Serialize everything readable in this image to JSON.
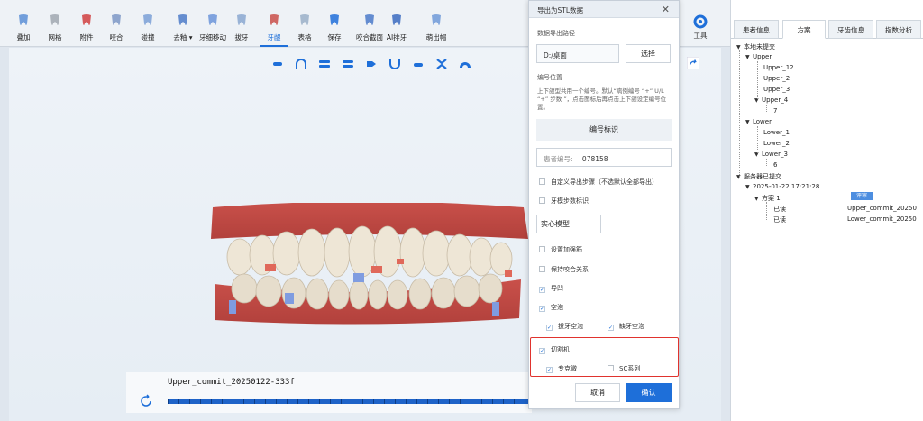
{
  "toolbar": {
    "items": [
      {
        "label": "叠加",
        "icon": "tooth-stack-icon"
      },
      {
        "label": "网格",
        "icon": "grid-icon"
      },
      {
        "label": "附件",
        "icon": "attachment-icon"
      },
      {
        "label": "咬合",
        "icon": "bite-icon"
      },
      {
        "label": "碰撞",
        "icon": "collision-icon"
      },
      {
        "label": "去釉 ▾",
        "icon": "enamel-removal-icon"
      },
      {
        "label": "牙细移动",
        "icon": "tooth-move-icon"
      },
      {
        "label": "拔牙",
        "icon": "extraction-icon"
      },
      {
        "label": "牙龈",
        "icon": "gum-icon"
      },
      {
        "label": "表格",
        "icon": "table-icon"
      },
      {
        "label": "保存",
        "icon": "save-icon"
      },
      {
        "label": "咬合截面",
        "icon": "bite-section-icon"
      },
      {
        "label": "AI排牙",
        "icon": "ai-arrange-icon"
      },
      {
        "label": "萌出帽",
        "icon": "eruption-cap-icon"
      }
    ],
    "active_index": 8,
    "tool_label": "工具"
  },
  "viewport": {
    "commit_name": "Upper_commit_20250122-333f"
  },
  "dialog": {
    "title": "导出为STL数据",
    "path_label": "数据导出路径",
    "path_value": "D:/桌面",
    "choose_button": "选择",
    "numbering_label": "编号位置",
    "numbering_note": "上下颌型共用一个编号。默认“病例编号 “+” U/L “+” 步数 ”，点击图标后再点击上下颌设定编号位置。",
    "numbering_button": "编号标识",
    "patient_no_label": "患者编号:",
    "patient_no_value": "078158",
    "custom_steps": "自定义导出步骤（不选默认全部导出）",
    "tooth_step_mark": "牙模步数标识",
    "model_type": "实心模型",
    "reinforce": "设置加强筋",
    "keep_bite": "保持咬合关系",
    "guide_groove": "导凹",
    "hollow": "空泡",
    "extraction_hollow": "拔牙空泡",
    "missing_hollow": "缺牙空泡",
    "cutter": "切割机",
    "kekang": "专克微",
    "sc_series": "SC系列",
    "cancel": "取消",
    "confirm": "确认"
  },
  "right_panel": {
    "tabs": [
      "患者信息",
      "方案",
      "牙齿信息",
      "指数分析"
    ],
    "active_tab": 1,
    "tree": {
      "local_root": "本地未提交",
      "upper": "Upper",
      "upper_items": [
        "Upper_12",
        "Upper_2",
        "Upper_3",
        "Upper_4"
      ],
      "upper_4_child": "7",
      "lower": "Lower",
      "lower_items": [
        "Lower_1",
        "Lower_2",
        "Lower_3"
      ],
      "lower_3_child": "6",
      "server_root": "服务器已提交",
      "date": "2025-01-22 17:21:28",
      "plan": "方案 1",
      "badge": "评审",
      "read_status": "已读",
      "file1": "Upper_commit_20250",
      "file2": "Lower_commit_20250"
    }
  },
  "colors": {
    "accent": "#1e6fd9",
    "highlight_border": "#e0332e",
    "gum": "#c9504a"
  }
}
